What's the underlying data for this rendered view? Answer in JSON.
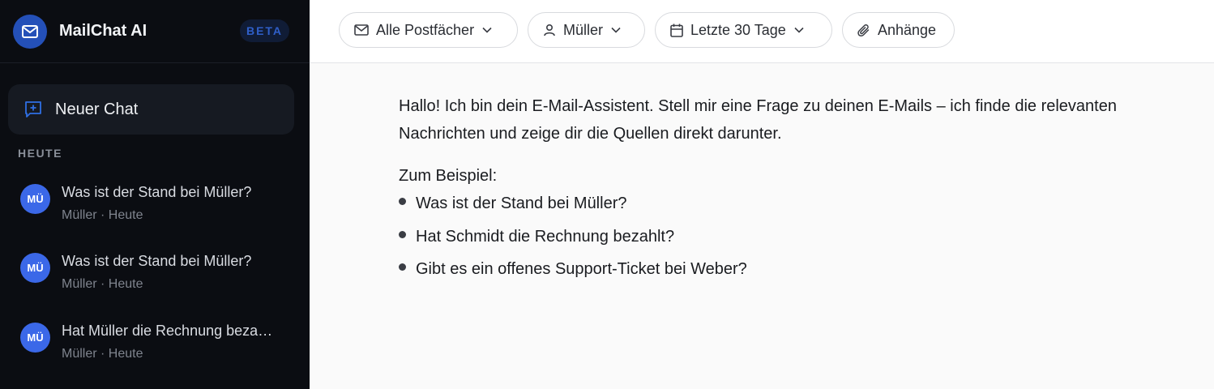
{
  "brand": {
    "name": "MailChat AI",
    "badge": "BETA",
    "logo_icon": "envelope-icon"
  },
  "sidebar": {
    "new_chat_label": "Neuer Chat",
    "section_label": "HEUTE",
    "chats": [
      {
        "avatar": "MÜ",
        "title": "Was ist der Stand bei Müller?",
        "sub": "Müller · Heute"
      },
      {
        "avatar": "MÜ",
        "title": "Was ist der Stand bei Müller?",
        "sub": "Müller · Heute"
      },
      {
        "avatar": "MÜ",
        "title": "Hat Müller die Rechnung bezahlt?",
        "sub": "Müller · Heute"
      }
    ]
  },
  "filters": [
    {
      "label": "Alle Postfächer",
      "icon": "mail-icon",
      "dropdown": true
    },
    {
      "label": "Müller",
      "icon": "user-icon",
      "dropdown": true
    },
    {
      "label": "Letzte 30 Tage",
      "icon": "calendar-icon",
      "dropdown": true
    },
    {
      "label": "Anhänge",
      "icon": "paperclip-icon",
      "dropdown": false
    }
  ],
  "assistant": {
    "intro": "Hallo! Ich bin dein E-Mail-Assistent. Stell mir eine Frage zu deinen E-Mails – ich finde die relevanten Nachrichten und zeige dir die Quellen direkt darunter.",
    "example_heading": "Zum Beispiel:",
    "examples": [
      "Was ist der Stand bei Müller?",
      "Hat Schmidt die Rechnung bezahlt?",
      "Gibt es ein offenes Support-Ticket bei Weber?"
    ]
  },
  "colors": {
    "sidebar_bg": "#0b0d12",
    "accent": "#3b68e8",
    "brand_logo": "#2450b8",
    "main_bg": "#fafafa"
  }
}
